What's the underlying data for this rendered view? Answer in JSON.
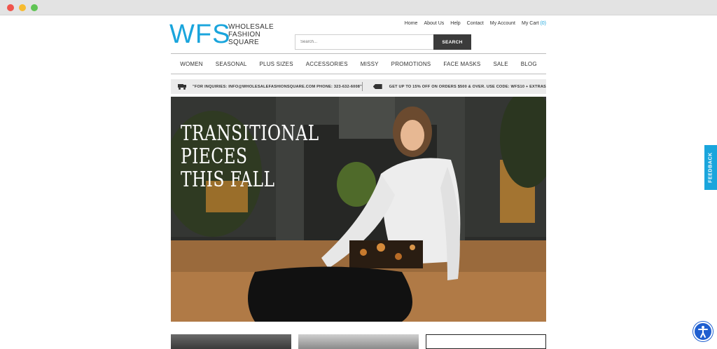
{
  "logo": {
    "mark": "WFS",
    "line1": "WHOLESALE",
    "line2": "FASHION",
    "line3": "SQUARE"
  },
  "toplinks": {
    "home": "Home",
    "about": "About Us",
    "help": "Help",
    "contact": "Contact",
    "account": "My Account",
    "cart": "My Cart",
    "cart_count": "(0)"
  },
  "search": {
    "placeholder": "Search...",
    "button": "SEARCH"
  },
  "nav": [
    "WOMEN",
    "SEASONAL",
    "PLUS SIZES",
    "ACCESSORIES",
    "MISSY",
    "PROMOTIONS",
    "FACE MASKS",
    "SALE",
    "BLOG"
  ],
  "promo": {
    "inquiries": "\"FOR INQUIRIES: INFO@WHOLESALEFASHIONSQUARE.COM PHONE: 323-632-6008\"",
    "offer": "GET UP TO 15% OFF ON ORDERS $500 & OVER. USE CODE: WFS10 + EXTRAS"
  },
  "hero": {
    "line1": "TRANSITIONAL",
    "line2": "PIECES",
    "line3": "THIS FALL"
  },
  "feedback": "FEEDBACK",
  "colors": {
    "brand_blue": "#1aa5dc",
    "dark_button": "#3b3b3b",
    "promo_bg": "#ebebeb"
  }
}
